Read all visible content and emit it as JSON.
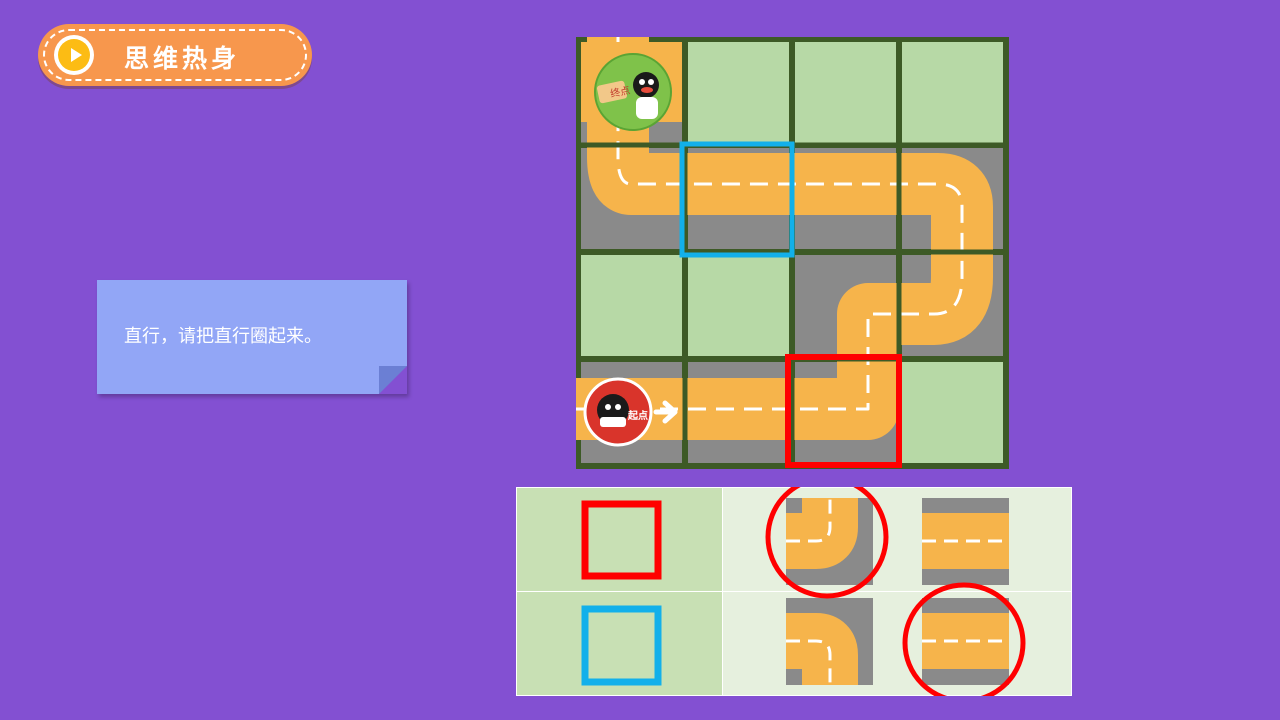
{
  "header": {
    "title": "思维热身",
    "icon": "play-icon"
  },
  "instruction": {
    "text": "直行，请把直行圈起来。"
  },
  "board": {
    "rows": 4,
    "cols": 4,
    "start_label": "起点",
    "end_label": "终点",
    "highlights": [
      {
        "color": "#ff0000",
        "row": 3,
        "col": 2
      },
      {
        "color": "#12b0ea",
        "row": 1,
        "col": 1
      }
    ]
  },
  "options": {
    "rows": [
      {
        "marker_color": "#ff0000",
        "tiles": [
          "curve-tile",
          "straight-tile"
        ],
        "circled": 0
      },
      {
        "marker_color": "#12b0ea",
        "tiles": [
          "curve-tile",
          "straight-tile"
        ],
        "circled": 1
      }
    ]
  },
  "colors": {
    "background": "#8350d2",
    "road": "#f6b44b",
    "curb": "#8a8a8a",
    "grass": "#b7d9a6",
    "grid_line": "#3d5a26",
    "red": "#ff0000",
    "blue": "#12b0ea",
    "title_pill": "#f7974d",
    "note": "#92a6f6"
  }
}
